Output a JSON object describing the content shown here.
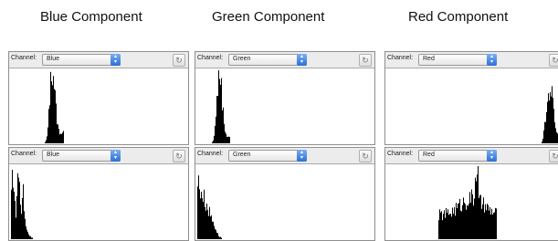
{
  "panels": [
    {
      "heading": "Blue Component",
      "top": {
        "channel_label": "Channel:",
        "channel_value": "Blue"
      },
      "bottom": {
        "channel_label": "Channel:",
        "channel_value": "Blue"
      }
    },
    {
      "heading": "Green Component",
      "top": {
        "channel_label": "Channel:",
        "channel_value": "Green"
      },
      "bottom": {
        "channel_label": "Channel:",
        "channel_value": "Green"
      }
    },
    {
      "heading": "Red Component",
      "top": {
        "channel_label": "Channel:",
        "channel_value": "Red"
      },
      "bottom": {
        "channel_label": "Channel:",
        "channel_value": "Red"
      }
    }
  ],
  "icons": {
    "select_arrows": "up-down-arrows-icon",
    "refresh": "refresh-icon"
  },
  "colors": {
    "select_accent": "#3a7be0",
    "histogram": "#000000",
    "toolbar": "#ececec"
  }
}
